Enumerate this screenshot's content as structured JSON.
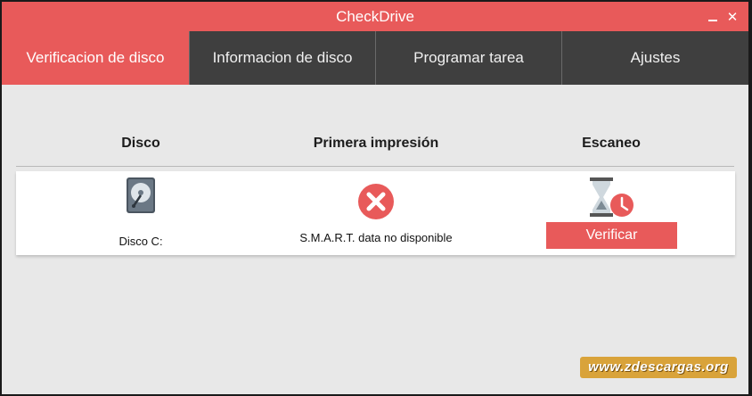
{
  "window": {
    "title": "CheckDrive",
    "minimize_icon": "minimize-icon",
    "close_glyph": "✕"
  },
  "tabs": [
    {
      "label": "Verificacion de disco",
      "active": true
    },
    {
      "label": "Informacion de disco",
      "active": false
    },
    {
      "label": "Programar tarea",
      "active": false
    },
    {
      "label": "Ajustes",
      "active": false
    }
  ],
  "table": {
    "headers": {
      "disk": "Disco",
      "impression": "Primera impresión",
      "scan": "Escaneo"
    },
    "rows": [
      {
        "disk_label": "Disco C:",
        "disk_icon": "hard-drive-icon",
        "status_icon": "error-x-icon",
        "status_text": "S.M.A.R.T. data no disponible",
        "scan_icon": "hourglass-clock-icon",
        "action_label": "Verificar"
      }
    ]
  },
  "watermark": {
    "text": "www.zdescargas.org"
  },
  "colors": {
    "accent": "#e85a5a",
    "tab_bg": "#3f3f3f",
    "content_bg": "#e8e8e8"
  }
}
